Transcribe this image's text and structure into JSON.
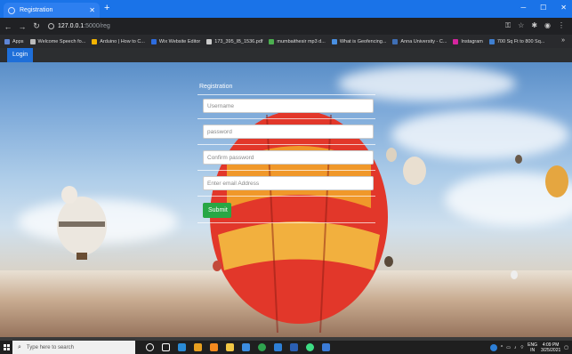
{
  "browser": {
    "tab_title": "Registration",
    "address_host": "127.0.0.1",
    "address_path": ":5000/reg",
    "bookmarks": [
      {
        "label": "Apps",
        "color": "#5f86d6"
      },
      {
        "label": "Welcome Speech fo...",
        "color": "#bbbbbb"
      },
      {
        "label": "Arduino | How to C...",
        "color": "#f4b400"
      },
      {
        "label": "Wix Website Editor",
        "color": "#2d6cdf"
      },
      {
        "label": "173_395_IB_1536.pdf",
        "color": "#cccccc"
      },
      {
        "label": "mumbaithesir mp3 d...",
        "color": "#4caf50"
      },
      {
        "label": "What is Geofencing...",
        "color": "#4a90e2"
      },
      {
        "label": "Anna University - C...",
        "color": "#3f6fb5"
      },
      {
        "label": "Instagram",
        "color": "#d6249f"
      },
      {
        "label": "700 Sq Ft to 800 Sq...",
        "color": "#3f7fd0"
      }
    ]
  },
  "app": {
    "nav_login": "Login",
    "form": {
      "title": "Registration",
      "username_placeholder": "Username",
      "password_placeholder": "password",
      "confirm_placeholder": "Confirm password",
      "email_placeholder": "Enter email Address",
      "submit_label": "Submit"
    }
  },
  "taskbar": {
    "search_placeholder": "Type here to search",
    "lang_top": "ENG",
    "lang_bottom": "IN",
    "time": "4:09 PM",
    "date": "3/25/2021"
  },
  "colors": {
    "accent": "#1a73e8",
    "submit": "#28a745"
  }
}
